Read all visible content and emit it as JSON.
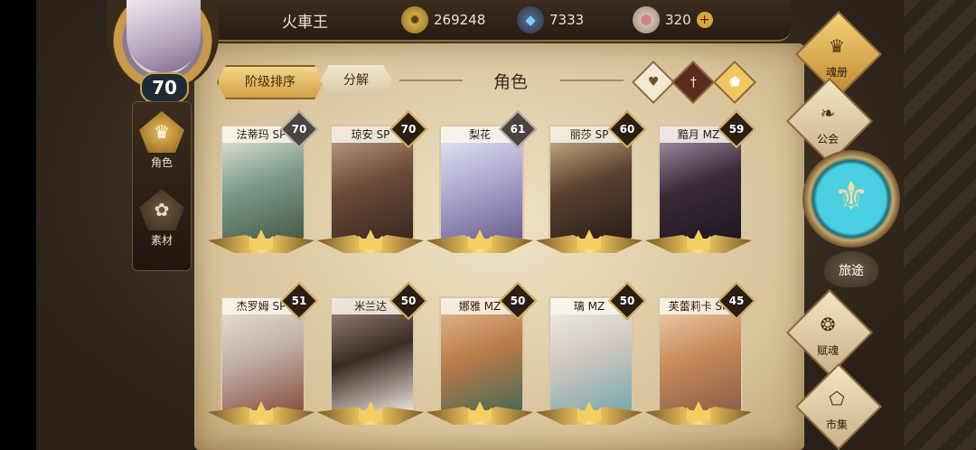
{
  "player": {
    "name": "火車王",
    "level": "70"
  },
  "resources": {
    "gold": "269248",
    "crystal": "7333",
    "gems": "320"
  },
  "left_nav": [
    {
      "label": "角色",
      "active": true
    },
    {
      "label": "素材",
      "active": false
    }
  ],
  "tabs": {
    "sort": "阶级排序",
    "decompose": "分解"
  },
  "section_title": "角色",
  "filters": [
    "heart-filter",
    "sword-filter",
    "shield-filter"
  ],
  "characters": [
    {
      "name": "法蒂玛 SP",
      "level": "70"
    },
    {
      "name": "琼安 SP",
      "level": "70"
    },
    {
      "name": "梨花",
      "level": "61"
    },
    {
      "name": "丽莎 SP",
      "level": "60"
    },
    {
      "name": "黯月 MZ",
      "level": "59"
    },
    {
      "name": "杰罗姆 SP",
      "level": "51"
    },
    {
      "name": "米兰达",
      "level": "50"
    },
    {
      "name": "娜雅 MZ",
      "level": "50"
    },
    {
      "name": "璃 MZ",
      "level": "50"
    },
    {
      "name": "芙蕾莉卡 SP",
      "level": "45"
    }
  ],
  "right_menu": {
    "soul_book": "魂册",
    "guild": "公会",
    "journey": "旅途",
    "talent": "赋魂",
    "market": "市集"
  },
  "colors": {
    "gold_accent": "#d8b060",
    "parchment": "#efe2c4",
    "dark_leather": "#2a2018"
  }
}
